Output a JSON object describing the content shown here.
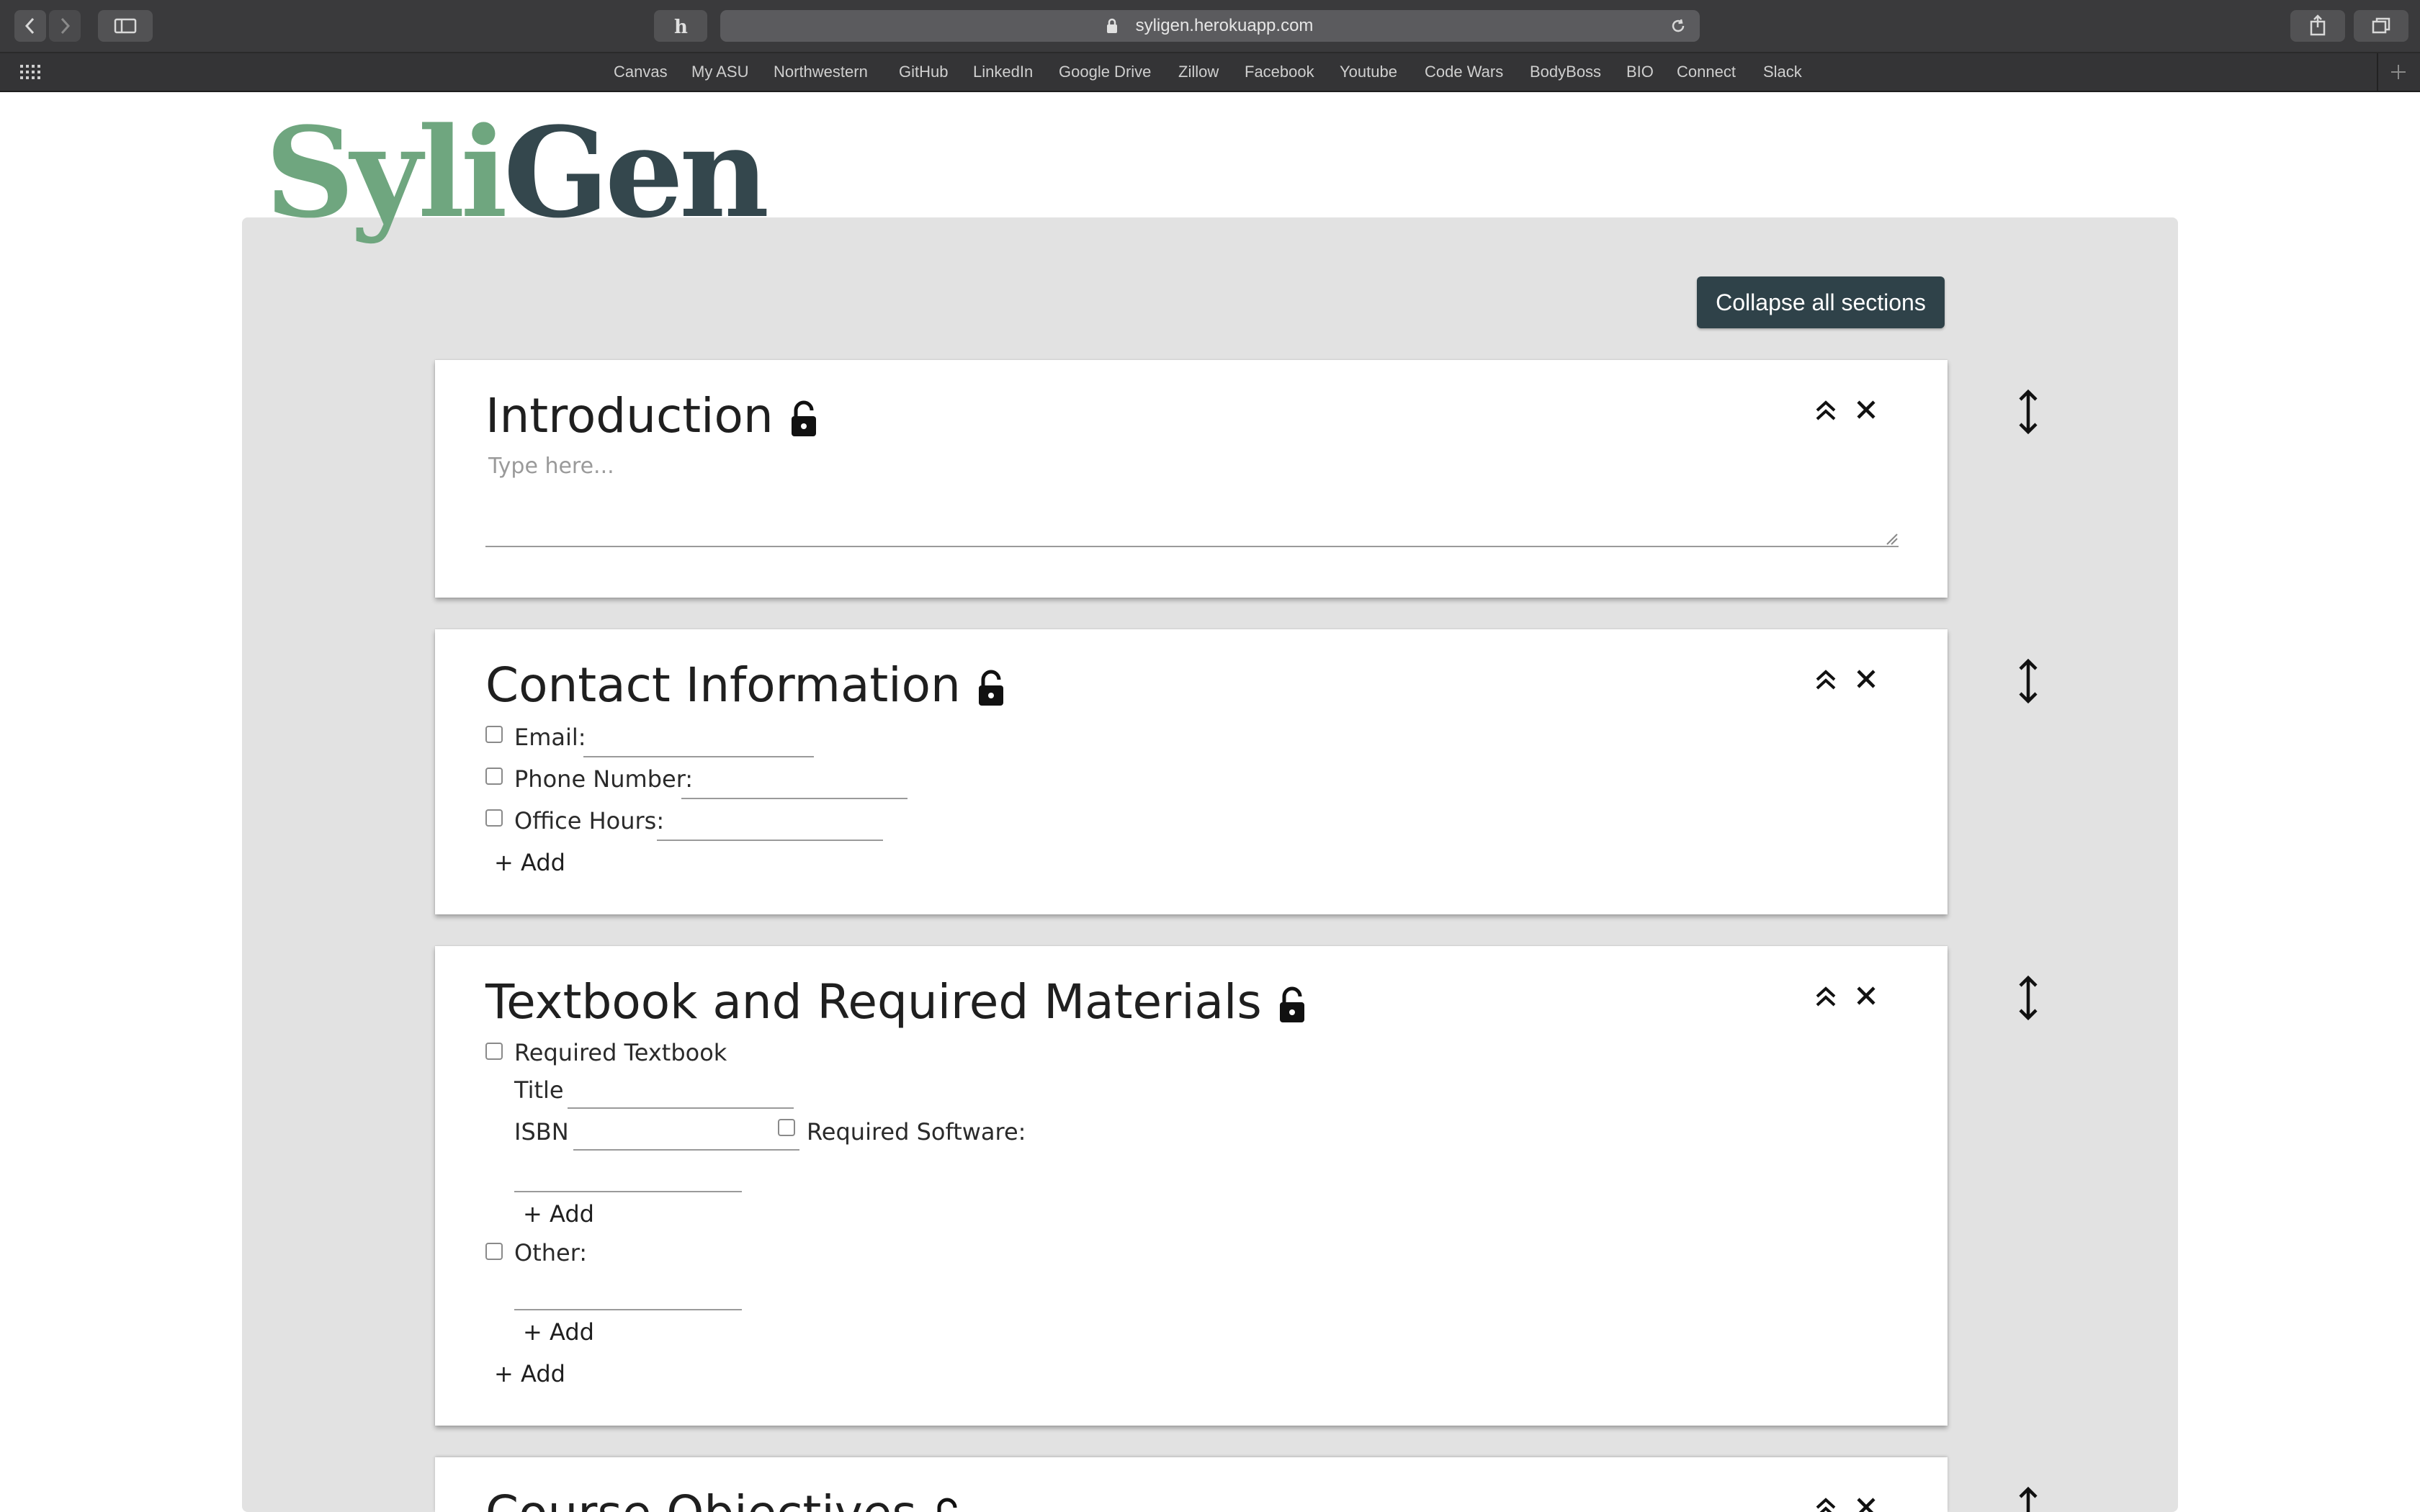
{
  "browser": {
    "url": "syligen.herokuapp.com",
    "bookmarks": [
      "Canvas",
      "My ASU",
      "Northwestern",
      "GitHub",
      "LinkedIn",
      "Google Drive",
      "Zillow",
      "Facebook",
      "Youtube",
      "Code Wars",
      "BodyBoss",
      "BIO",
      "Connect",
      "Slack"
    ]
  },
  "logo": {
    "part1": "Syli",
    "part2": "Gen"
  },
  "collapse_all_label": "Collapse all sections",
  "sections": {
    "intro": {
      "title": "Introduction",
      "placeholder": "Type here..."
    },
    "contact": {
      "title": "Contact Information",
      "fields": [
        "Email:",
        "Phone Number:",
        "Office Hours:"
      ],
      "add_label": "+ Add"
    },
    "textbook": {
      "title": "Textbook and Required Materials",
      "required_textbook": "Required Textbook",
      "title_label": "Title",
      "isbn_label": "ISBN",
      "required_software": "Required Software:",
      "add_software": "+ Add",
      "other_label": "Other:",
      "add_other": "+ Add",
      "add_label": "+ Add"
    },
    "objectives": {
      "title": "Course Objectives"
    }
  },
  "colors": {
    "logo_green": "#6fa67f",
    "logo_dark": "#34474d",
    "button_bg": "#2f4249",
    "panel_bg": "#e2e2e2"
  },
  "icons": {
    "lock": "lock-icon",
    "collapse": "double-chevron-up-icon",
    "close": "close-icon",
    "move": "vertical-resize-icon"
  }
}
